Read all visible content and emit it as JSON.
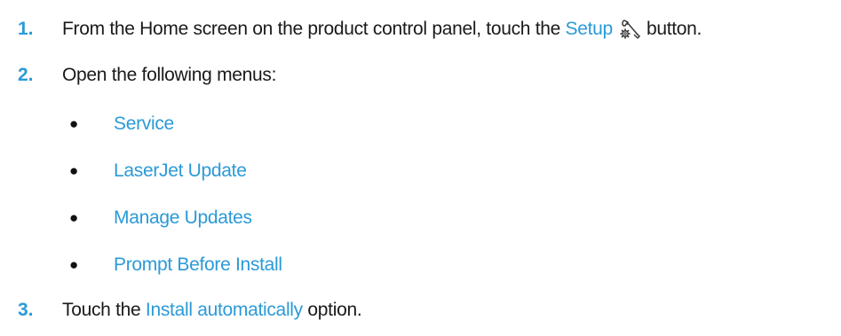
{
  "steps": [
    {
      "number": "1.",
      "text_before": "From the Home screen on the product control panel, touch the ",
      "link": "Setup",
      "icon": "setup-wrench-gear-icon",
      "text_after": " button."
    },
    {
      "number": "2.",
      "text": "Open the following menus:",
      "menus": [
        "Service",
        "LaserJet Update",
        "Manage Updates",
        "Prompt Before Install"
      ]
    },
    {
      "number": "3.",
      "text_before": "Touch the ",
      "link": "Install automatically",
      "text_after": " option."
    }
  ],
  "bullet_glyph": "●",
  "colors": {
    "accent": "#2b9ad8",
    "text": "#1a1a1a"
  }
}
